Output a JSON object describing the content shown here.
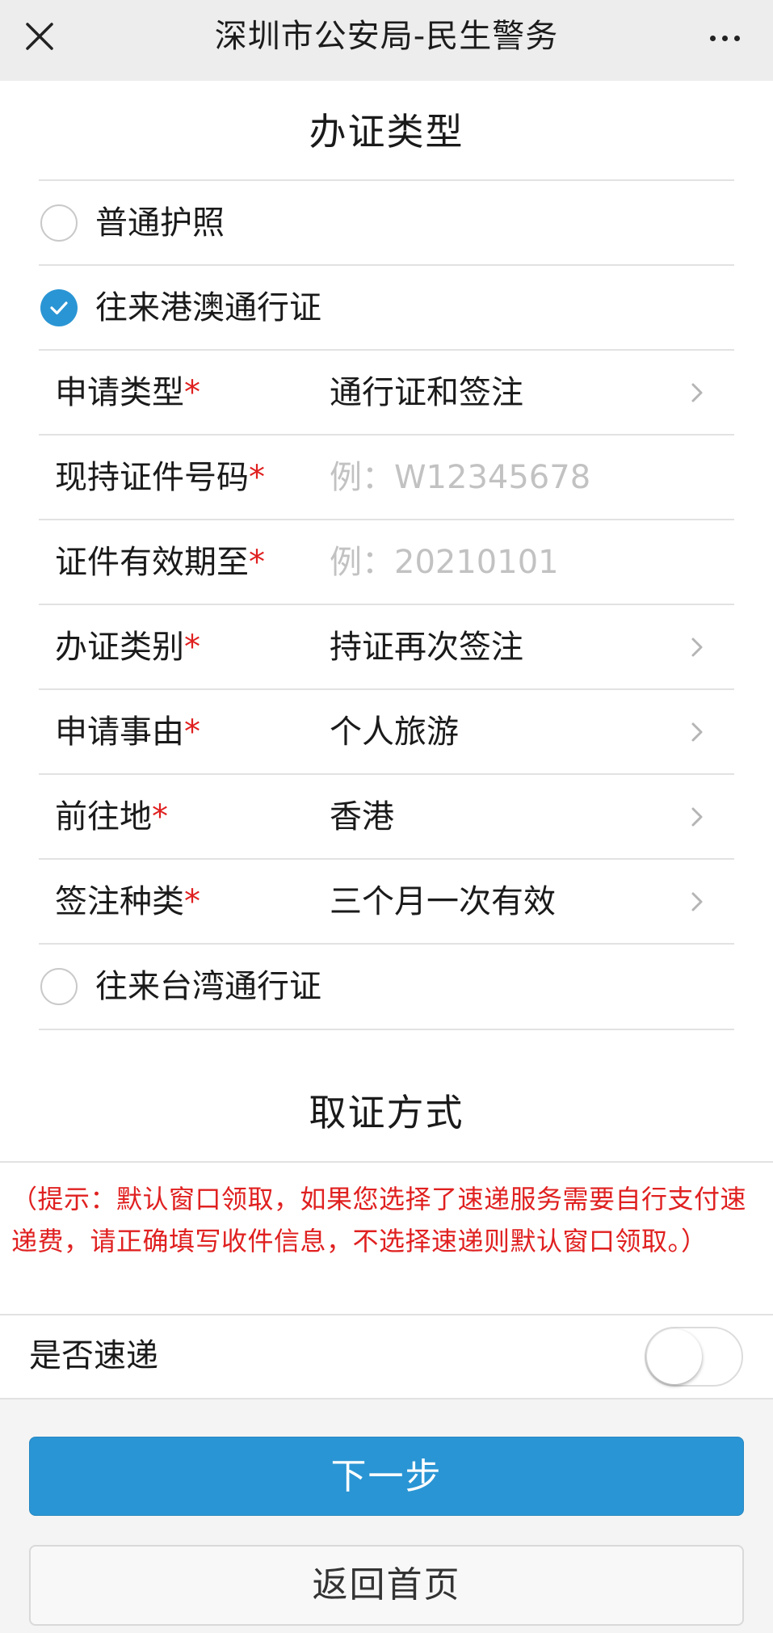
{
  "navbar": {
    "title": "深圳市公安局-民生警务",
    "close_icon": "close-icon",
    "more_icon": "more-icon"
  },
  "cert_type": {
    "title": "办证类型",
    "options": [
      {
        "label": "普通护照",
        "checked": false
      },
      {
        "label": "往来港澳通行证",
        "checked": true
      },
      {
        "label": "往来台湾通行证",
        "checked": false
      }
    ],
    "fields": {
      "apply_type": {
        "label": "申请类型",
        "value": "通行证和签注"
      },
      "current_cert_no": {
        "label": "现持证件号码",
        "placeholder": "例：W12345678"
      },
      "valid_until": {
        "label": "证件有效期至",
        "placeholder": "例：20210101"
      },
      "category": {
        "label": "办证类别",
        "value": "持证再次签注"
      },
      "reason": {
        "label": "申请事由",
        "value": "个人旅游"
      },
      "destination": {
        "label": "前往地",
        "value": "香港"
      },
      "endorsement_type": {
        "label": "签注种类",
        "value": "三个月一次有效"
      }
    },
    "required_mark": "*"
  },
  "pickup": {
    "title": "取证方式",
    "tip": "（提示：默认窗口领取，如果您选择了速递服务需要自行支付速递费，请正确填写收件信息，不选择速递则默认窗口领取。）",
    "express_label": "是否速递",
    "express_enabled": false
  },
  "actions": {
    "next_label": "下一步",
    "home_label": "返回首页"
  },
  "colors": {
    "accent": "#2a95d4",
    "required": "#e02020",
    "navbar_bg": "#ededed"
  }
}
